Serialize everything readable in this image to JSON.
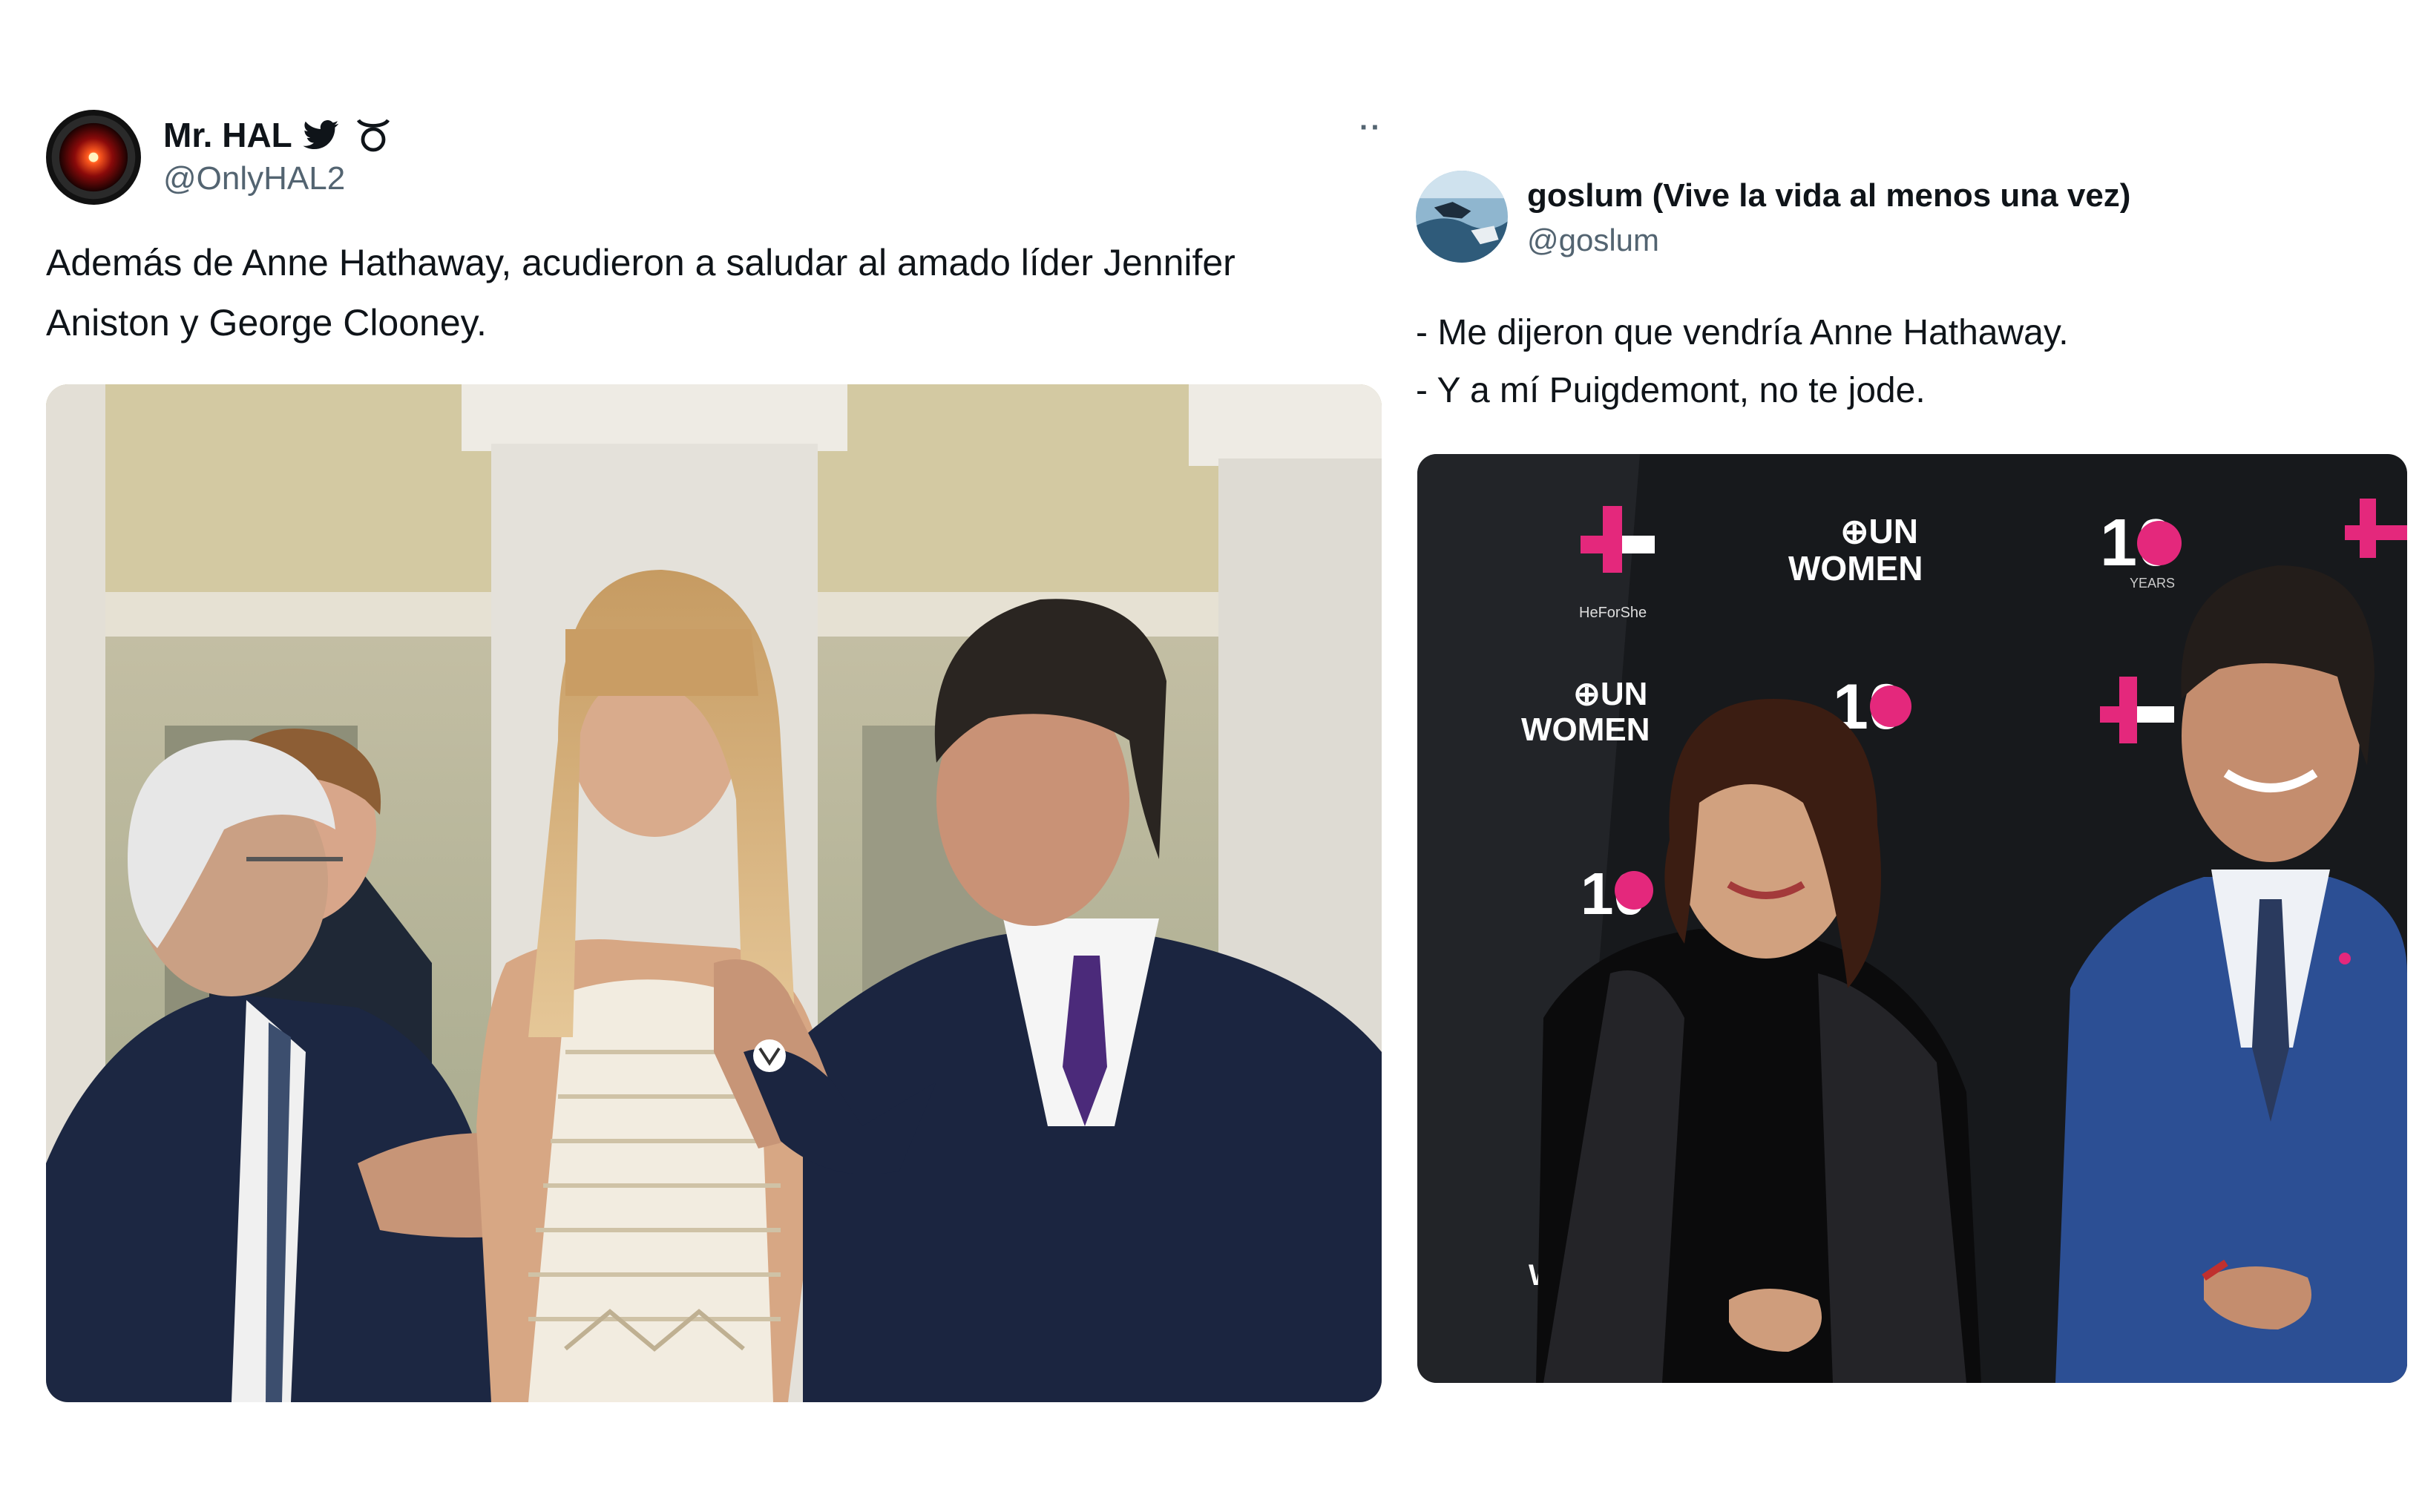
{
  "tweet_left": {
    "display_name": "Mr. HAL",
    "bird_glyph": "🐦",
    "badge_glyph": "♉",
    "handle": "@OnlyHAL2",
    "more_glyph": "··",
    "text_lines": [
      "Además de Anne Hathaway, acudieron a saludar al amado líder Jennifer",
      "Aniston y George Clooney."
    ],
    "avatar_icon": "hal-9000-eye-icon"
  },
  "tweet_right": {
    "display_name": "goslum (Vive la vida al menos una vez)",
    "handle": "@goslum",
    "text_lines": [
      "- Me dijeron que vendría Anne Hathaway.",
      "- Y a mí Puigdemont, no te jode."
    ],
    "backdrop": {
      "un_line1": "⊕UN",
      "un_line2": "WOMEN",
      "ten": "10",
      "heforshe": "HeForShe",
      "years": "YEARS",
      "partial_w": "W"
    }
  },
  "colors": {
    "handle_gray": "#536471",
    "text_dark": "#0f1419",
    "heforshe_pink": "#e4287c",
    "backdrop_dark": "#17191c",
    "suit_navy": "#1c2742",
    "suit_blue": "#2c4f94"
  }
}
